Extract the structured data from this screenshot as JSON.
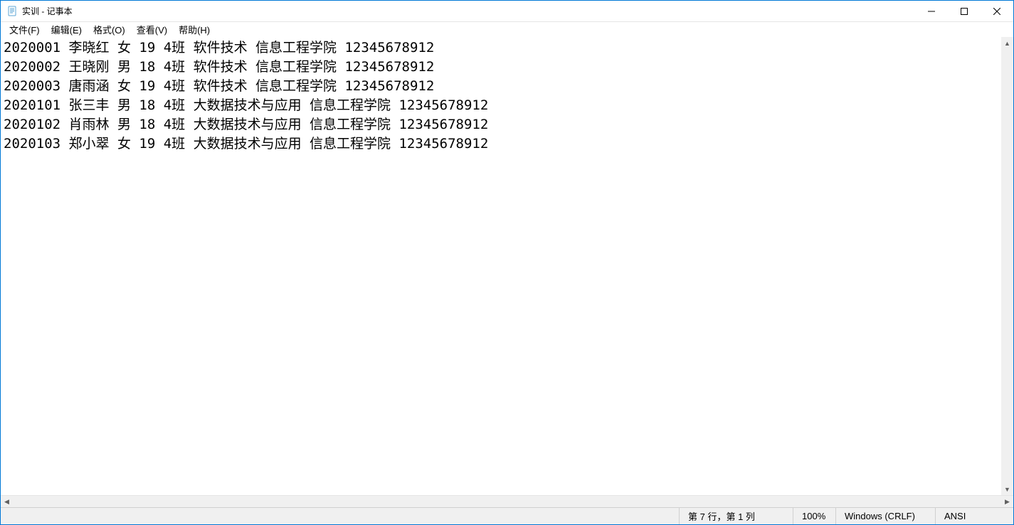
{
  "window": {
    "title": "实训 - 记事本"
  },
  "menu": {
    "file": "文件(F)",
    "edit": "编辑(E)",
    "format": "格式(O)",
    "view": "查看(V)",
    "help": "帮助(H)"
  },
  "content": {
    "lines": [
      "2020001 李晓红 女 19 4班 软件技术 信息工程学院 12345678912",
      "2020002 王晓刚 男 18 4班 软件技术 信息工程学院 12345678912",
      "2020003 唐雨涵 女 19 4班 软件技术 信息工程学院 12345678912",
      "2020101 张三丰 男 18 4班 大数据技术与应用 信息工程学院 12345678912",
      "2020102 肖雨林 男 18 4班 大数据技术与应用 信息工程学院 12345678912",
      "2020103 郑小翠 女 19 4班 大数据技术与应用 信息工程学院 12345678912"
    ]
  },
  "statusbar": {
    "position": "第 7 行，第 1 列",
    "zoom": "100%",
    "line_ending": "Windows (CRLF)",
    "encoding": "ANSI"
  }
}
